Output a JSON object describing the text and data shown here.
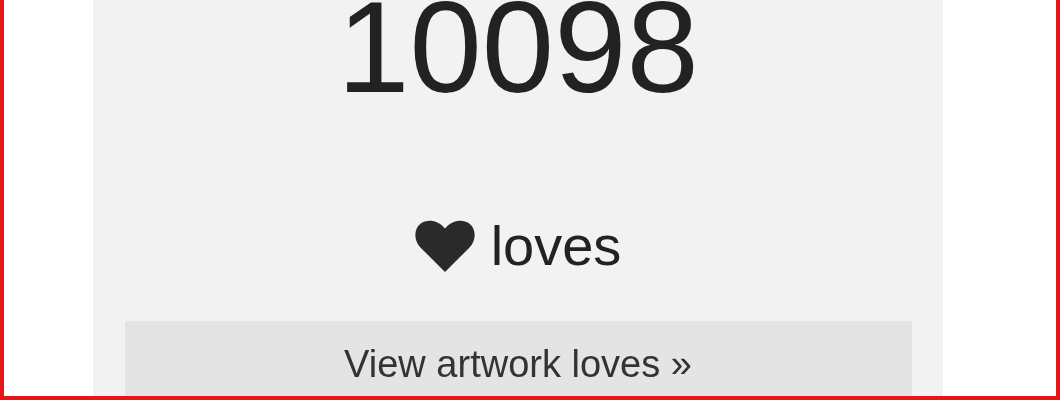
{
  "count": "10098",
  "loves_label": "loves",
  "button": {
    "label": "View artwork loves »"
  }
}
